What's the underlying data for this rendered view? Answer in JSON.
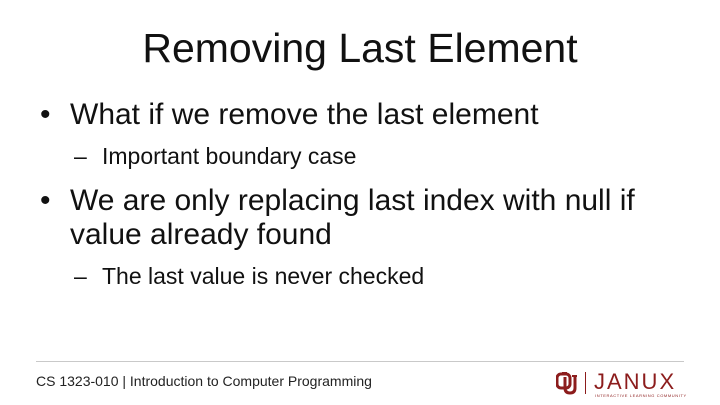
{
  "slide": {
    "title": "Removing Last Element",
    "bullets": [
      {
        "text": "What if we remove the last element",
        "sub": [
          "Important boundary case"
        ]
      },
      {
        "text": "We are only replacing last index with null if value already found",
        "sub": [
          "The last value is never checked"
        ]
      }
    ],
    "bullet_symbol": "•",
    "sub_symbol": "–"
  },
  "footer": {
    "course_text": "CS 1323-010 | Introduction to Computer Programming",
    "logo": {
      "wordmark": "JANUX",
      "tagline": "INTERACTIVE LEARNING COMMUNITY",
      "brand_color": "#8c1c1c",
      "icon": "ou-interlocking-logo-icon"
    }
  }
}
